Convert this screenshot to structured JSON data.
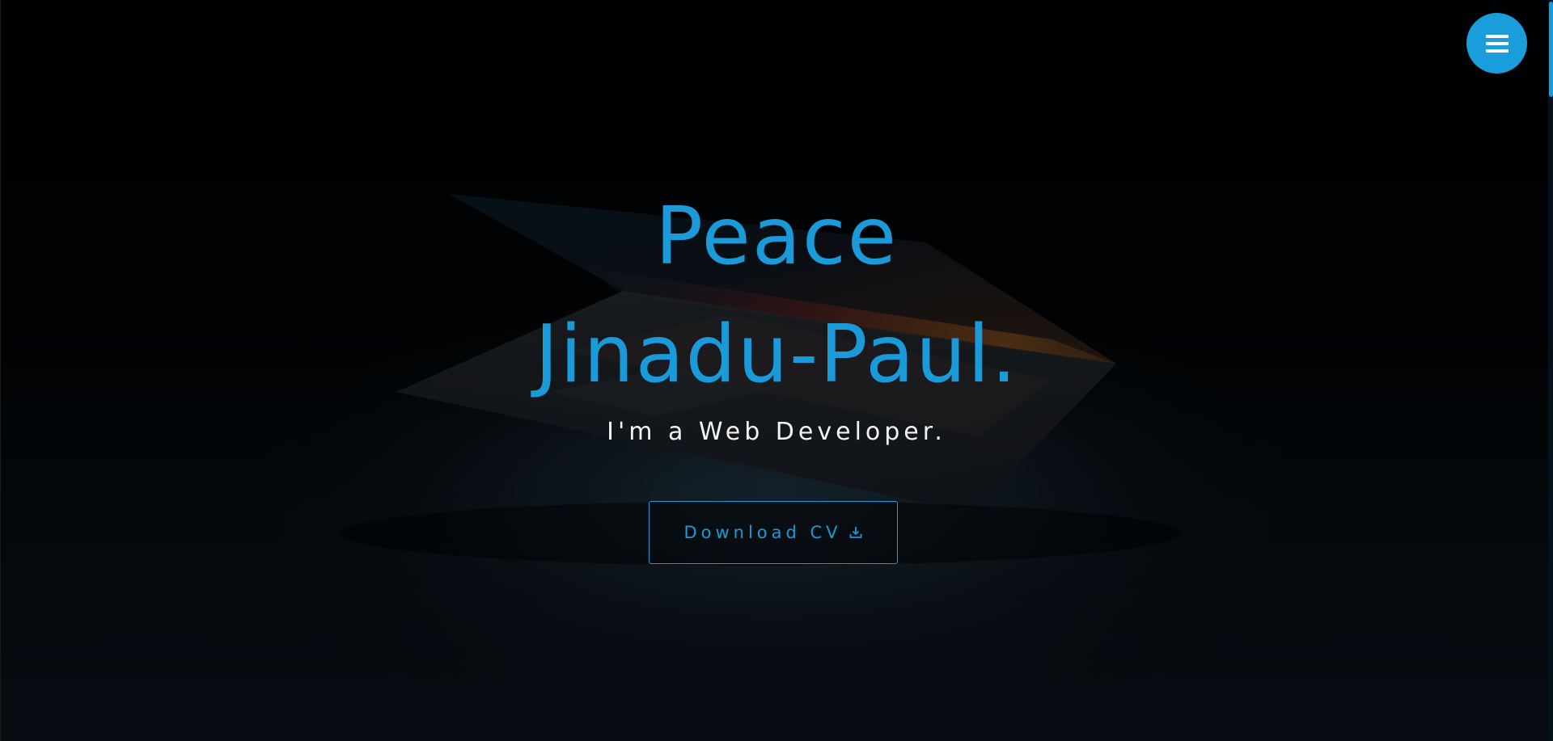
{
  "hero": {
    "name_line1": "Peace",
    "name_line2": "Jinadu-Paul.",
    "subtitle": "I'm a Web Developer.",
    "cta_label": "Download CV",
    "cta_icon": "download-icon"
  },
  "nav": {
    "menu_icon": "hamburger-menu-icon"
  },
  "colors": {
    "accent": "#1a9ad8",
    "text_light": "#f2f2f2",
    "background": "#020406"
  }
}
